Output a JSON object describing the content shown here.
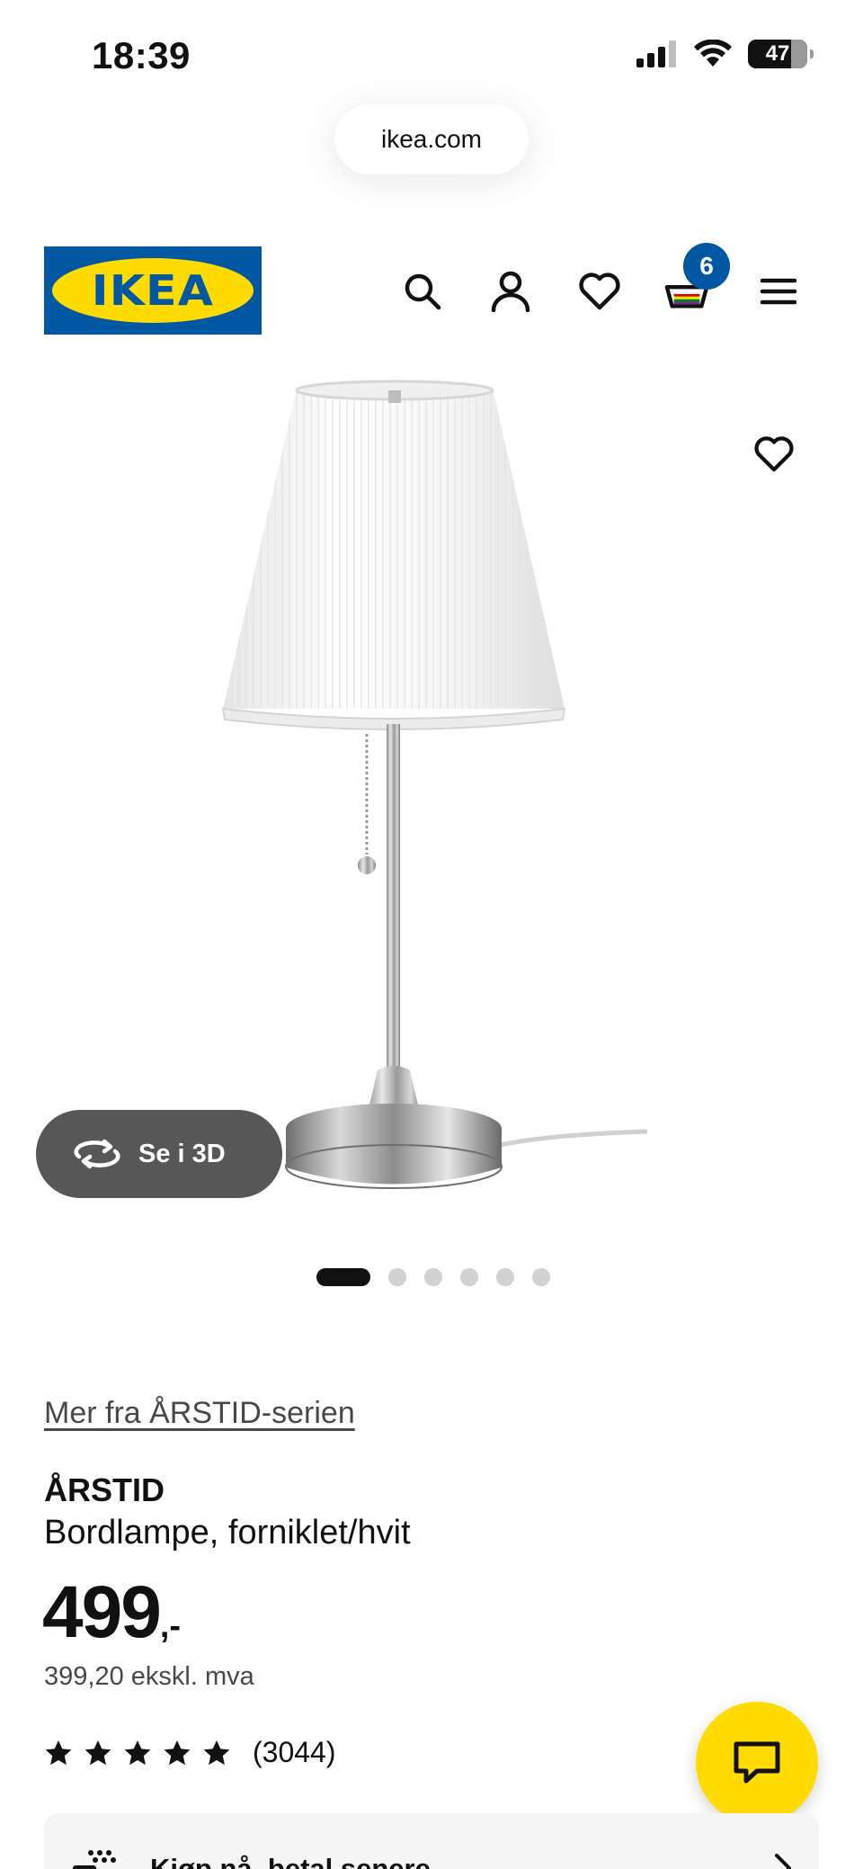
{
  "status_bar": {
    "time": "18:39",
    "battery": "47",
    "icons": [
      "cellular-signal-icon",
      "wifi-icon",
      "battery-icon"
    ]
  },
  "browser": {
    "url": "ikea.com"
  },
  "header": {
    "logo_text": "IKEA",
    "brand_colors": {
      "blue": "#0058a3",
      "yellow": "#ffdb00"
    },
    "cart_count": "6",
    "icons": [
      "search-icon",
      "account-icon",
      "heart-icon",
      "cart-icon",
      "menu-icon"
    ]
  },
  "gallery": {
    "view_3d_label": "Se i 3D",
    "image_count": 6,
    "active_index": 0
  },
  "product": {
    "series_link": "Mer fra ÅRSTID-serien",
    "name": "ÅRSTID",
    "description": "Bordlampe, forniklet/hvit",
    "price": "499",
    "price_suffix": ",-",
    "price_ex_vat": "399,20 ekskl. mva",
    "rating_stars": 5,
    "rating_count": "(3044)"
  },
  "pay_later": {
    "label": "Kjøp nå, betal senere"
  }
}
